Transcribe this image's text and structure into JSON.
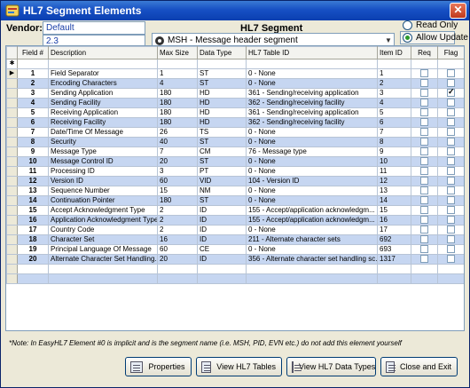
{
  "window": {
    "title": "HL7 Segment Elements",
    "close_glyph": "✕"
  },
  "vendor": {
    "label": "Vendor:",
    "name": "Default",
    "version": "2.3"
  },
  "segment": {
    "label": "HL7 Segment",
    "selected": "MSH - Message header segment"
  },
  "mode": {
    "read_only": "Read Only",
    "allow_update": "Allow Update",
    "selected": "allow_update"
  },
  "grid": {
    "columns": [
      "Field #",
      "Description",
      "Max Size",
      "Data Type",
      "HL7 Table ID",
      "Item ID",
      "Req",
      "Flag"
    ],
    "new_row_marker": "✱",
    "current_row_marker": "▶",
    "rows": [
      {
        "n": "1",
        "desc": "Field Separator",
        "size": "1",
        "type": "ST",
        "table": "0 - None",
        "item": "1",
        "req": false,
        "flag": false
      },
      {
        "n": "2",
        "desc": "Encoding Characters",
        "size": "4",
        "type": "ST",
        "table": "0 - None",
        "item": "2",
        "req": false,
        "flag": false
      },
      {
        "n": "3",
        "desc": "Sending Application",
        "size": "180",
        "type": "HD",
        "table": "361 - Sending/receiving application",
        "item": "3",
        "req": false,
        "flag": true
      },
      {
        "n": "4",
        "desc": "Sending Facility",
        "size": "180",
        "type": "HD",
        "table": "362 - Sending/receiving facility",
        "item": "4",
        "req": false,
        "flag": false
      },
      {
        "n": "5",
        "desc": "Receiving Application",
        "size": "180",
        "type": "HD",
        "table": "361 - Sending/receiving application",
        "item": "5",
        "req": false,
        "flag": false
      },
      {
        "n": "6",
        "desc": "Receiving Facility",
        "size": "180",
        "type": "HD",
        "table": "362 - Sending/receiving facility",
        "item": "6",
        "req": false,
        "flag": false
      },
      {
        "n": "7",
        "desc": "Date/Time Of Message",
        "size": "26",
        "type": "TS",
        "table": "0 - None",
        "item": "7",
        "req": false,
        "flag": false
      },
      {
        "n": "8",
        "desc": "Security",
        "size": "40",
        "type": "ST",
        "table": "0 - None",
        "item": "8",
        "req": false,
        "flag": false
      },
      {
        "n": "9",
        "desc": "Message Type",
        "size": "7",
        "type": "CM",
        "table": "76 - Message type",
        "item": "9",
        "req": false,
        "flag": false
      },
      {
        "n": "10",
        "desc": "Message Control ID",
        "size": "20",
        "type": "ST",
        "table": "0 - None",
        "item": "10",
        "req": false,
        "flag": false
      },
      {
        "n": "11",
        "desc": "Processing ID",
        "size": "3",
        "type": "PT",
        "table": "0 - None",
        "item": "11",
        "req": false,
        "flag": false
      },
      {
        "n": "12",
        "desc": "Version ID",
        "size": "60",
        "type": "VID",
        "table": "104 - Version ID",
        "item": "12",
        "req": false,
        "flag": false
      },
      {
        "n": "13",
        "desc": "Sequence Number",
        "size": "15",
        "type": "NM",
        "table": "0 - None",
        "item": "13",
        "req": false,
        "flag": false
      },
      {
        "n": "14",
        "desc": "Continuation Pointer",
        "size": "180",
        "type": "ST",
        "table": "0 - None",
        "item": "14",
        "req": false,
        "flag": false
      },
      {
        "n": "15",
        "desc": "Accept Acknowledgment Type",
        "size": "2",
        "type": "ID",
        "table": "155 - Accept/application acknowledgm...",
        "item": "15",
        "req": false,
        "flag": false
      },
      {
        "n": "16",
        "desc": "Application Acknowledgment Type",
        "size": "2",
        "type": "ID",
        "table": "155 - Accept/application acknowledgm...",
        "item": "16",
        "req": false,
        "flag": false
      },
      {
        "n": "17",
        "desc": "Country Code",
        "size": "2",
        "type": "ID",
        "table": "0 - None",
        "item": "17",
        "req": false,
        "flag": false
      },
      {
        "n": "18",
        "desc": "Character Set",
        "size": "16",
        "type": "ID",
        "table": "211 - Alternate character sets",
        "item": "692",
        "req": false,
        "flag": false
      },
      {
        "n": "19",
        "desc": "Principal Language Of Message",
        "size": "60",
        "type": "CE",
        "table": "0 - None",
        "item": "693",
        "req": false,
        "flag": false
      },
      {
        "n": "20",
        "desc": "Alternate Character Set Handling...",
        "size": "20",
        "type": "ID",
        "table": "356 - Alternate character set handling sc...",
        "item": "1317",
        "req": false,
        "flag": false
      }
    ]
  },
  "note": "*Note:  In EasyHL7 Element #0 is implicit and is the segment name (i.e. MSH, PID, EVN etc.) do not add this element yourself",
  "buttons": {
    "properties": "Properties",
    "view_tables": "View HL7 Tables",
    "view_data_types": "View HL7 Data Types",
    "close": "Close and Exit"
  },
  "colors": {
    "title_bar": "#1750c4",
    "row_alt": "#c6d6f1",
    "selected_text": "#1a3fa8"
  }
}
